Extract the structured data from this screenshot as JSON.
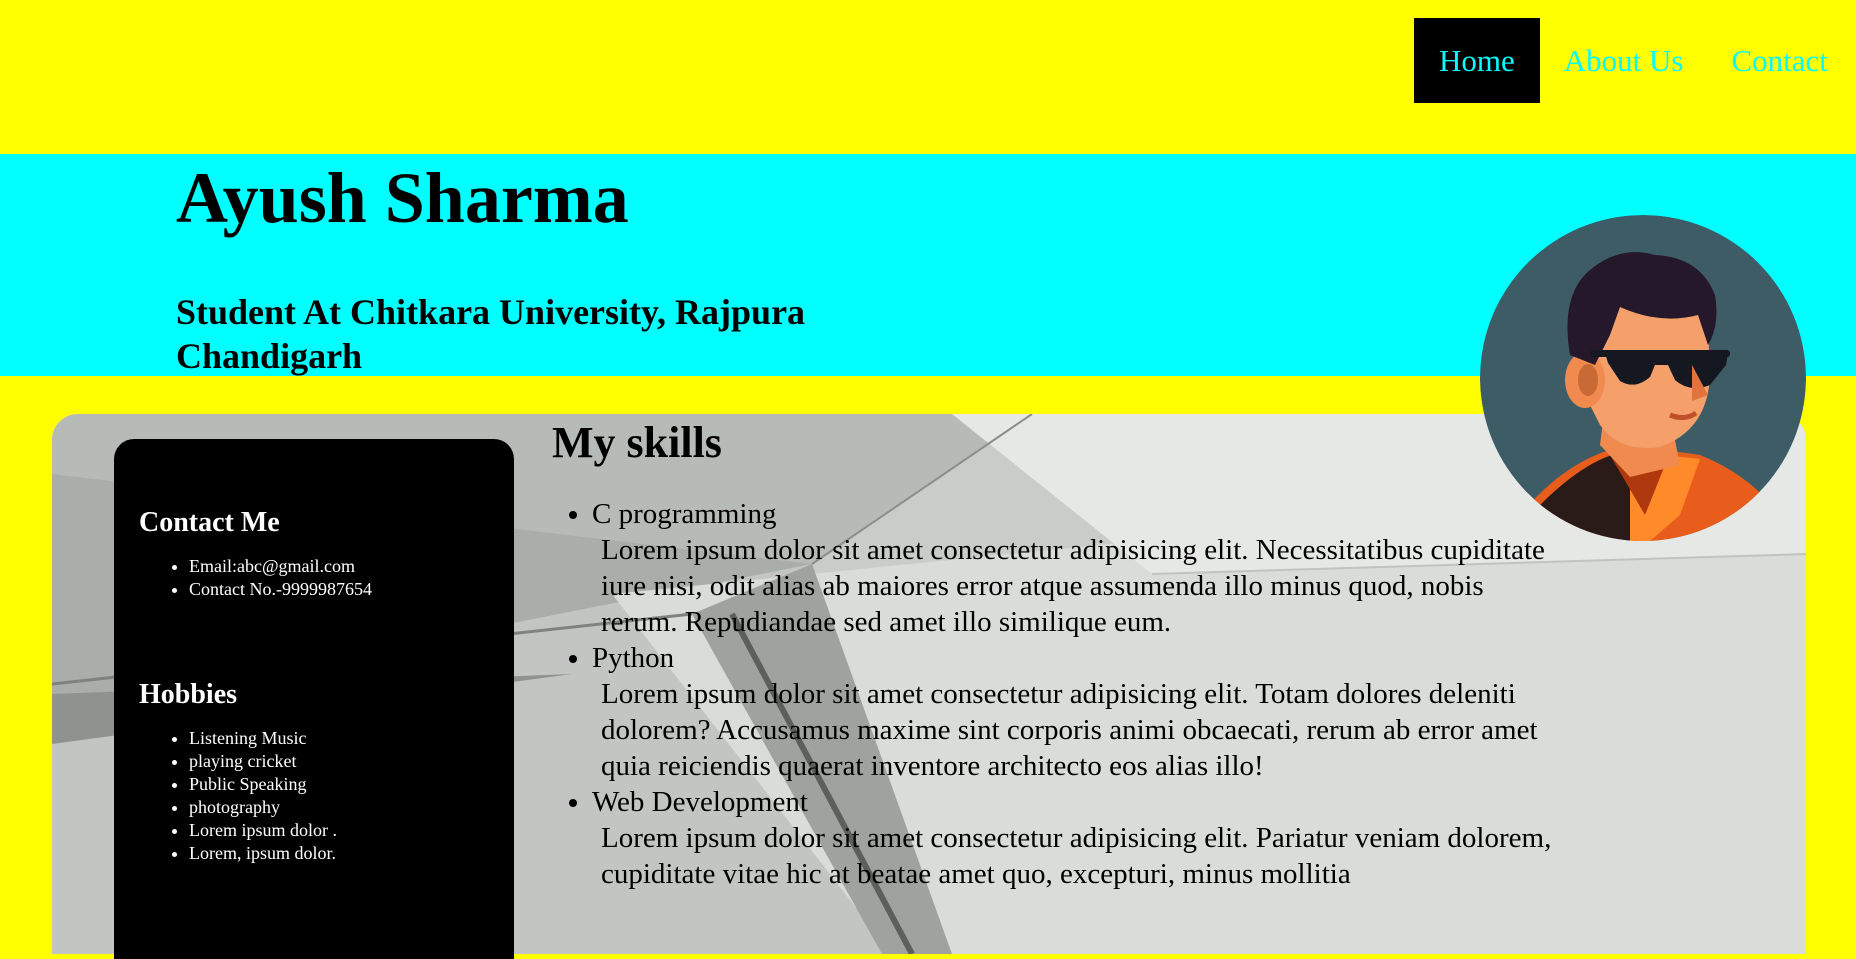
{
  "nav": {
    "items": [
      {
        "label": "Home",
        "active": true
      },
      {
        "label": "About Us",
        "active": false
      },
      {
        "label": "Contact",
        "active": false
      }
    ]
  },
  "header": {
    "name": "Ayush Sharma",
    "subtitle": "Student At Chitkara University, Rajpura Chandigarh"
  },
  "sidebar": {
    "contact_heading": "Contact Me",
    "contact_items": [
      "Email:abc@gmail.com",
      "Contact No.-9999987654"
    ],
    "hobbies_heading": "Hobbies",
    "hobbies": [
      "Listening Music",
      "playing cricket",
      "Public Speaking",
      "photography",
      "Lorem ipsum dolor .",
      "Lorem, ipsum dolor."
    ]
  },
  "skills": {
    "heading": "My skills",
    "items": [
      {
        "title": "C programming",
        "desc": "Lorem ipsum dolor sit amet consectetur adipisicing elit. Necessitatibus cupiditate iure nisi, odit alias ab maiores error atque assumenda illo minus quod, nobis rerum. Repudiandae sed amet illo similique eum."
      },
      {
        "title": "Python",
        "desc": "Lorem ipsum dolor sit amet consectetur adipisicing elit. Totam dolores deleniti dolorem? Accusamus maxime sint corporis animi obcaecati, rerum ab error amet quia reiciendis quaerat inventore architecto eos alias illo!"
      },
      {
        "title": "Web Development",
        "desc": "Lorem ipsum dolor sit amet consectetur adipisicing elit. Pariatur veniam dolorem, cupiditate vitae hic at beatae amet quo, excepturi, minus mollitia"
      }
    ]
  },
  "colors": {
    "page_bg": "#ffff00",
    "header_band": "#00ffff",
    "nav_text": "#00ffff",
    "nav_active_bg": "#000000",
    "sidebar_bg": "#000000"
  },
  "icons": {
    "avatar": "avatar-illustration"
  }
}
